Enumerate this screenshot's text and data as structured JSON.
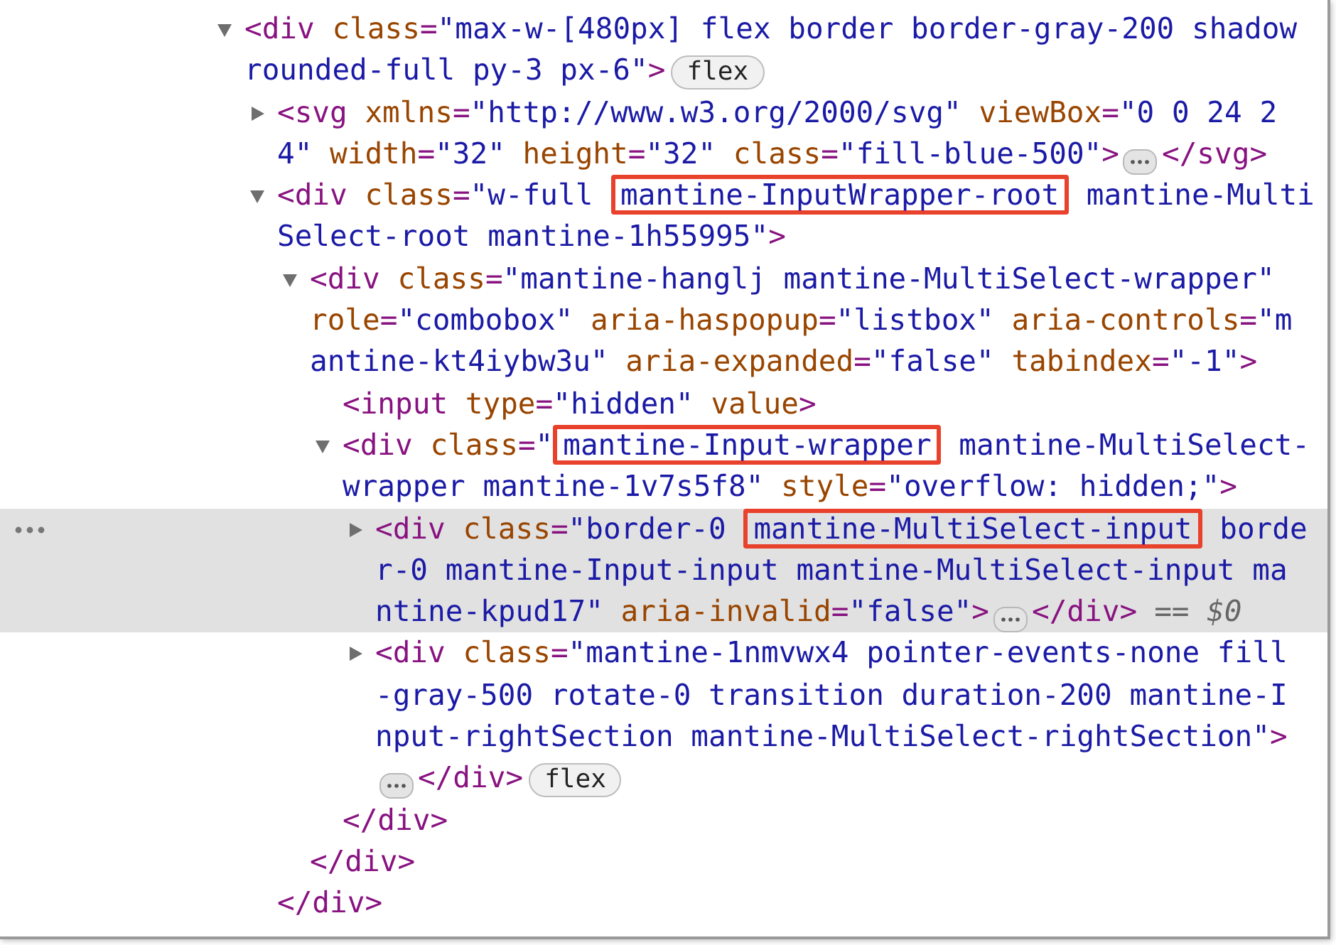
{
  "dom_tree": [
    {
      "expanded": true,
      "selected": false,
      "lines": [
        [
          {
            "kind": "tag",
            "text": "<div"
          },
          {
            "kind": "attr",
            "text": " class"
          },
          {
            "kind": "tag",
            "text": "="
          },
          {
            "kind": "value",
            "text": "\"max-w-[480px] flex border border-gray-200 shadow"
          }
        ],
        [
          {
            "kind": "value",
            "text": "rounded-full py-3 px-6\""
          },
          {
            "kind": "tag",
            "text": ">"
          },
          {
            "kind": "badge",
            "text": "flex"
          }
        ]
      ],
      "children": [
        {
          "expanded": false,
          "selected": false,
          "lines": [
            [
              {
                "kind": "tag",
                "text": "<svg"
              },
              {
                "kind": "attr",
                "text": " xmlns"
              },
              {
                "kind": "tag",
                "text": "="
              },
              {
                "kind": "value",
                "text": "\"http://www.w3.org/2000/svg\""
              },
              {
                "kind": "attr",
                "text": " viewBox"
              },
              {
                "kind": "tag",
                "text": "="
              },
              {
                "kind": "value",
                "text": "\"0 0 24 2"
              }
            ],
            [
              {
                "kind": "value",
                "text": "4\""
              },
              {
                "kind": "attr",
                "text": " width"
              },
              {
                "kind": "tag",
                "text": "="
              },
              {
                "kind": "value",
                "text": "\"32\""
              },
              {
                "kind": "attr",
                "text": " height"
              },
              {
                "kind": "tag",
                "text": "="
              },
              {
                "kind": "value",
                "text": "\"32\""
              },
              {
                "kind": "attr",
                "text": " class"
              },
              {
                "kind": "tag",
                "text": "="
              },
              {
                "kind": "value",
                "text": "\"fill-blue-500\""
              },
              {
                "kind": "tag",
                "text": ">"
              },
              {
                "kind": "ellipsis"
              },
              {
                "kind": "tag",
                "text": "</svg>"
              }
            ]
          ]
        },
        {
          "expanded": true,
          "selected": false,
          "lines": [
            [
              {
                "kind": "tag",
                "text": "<div"
              },
              {
                "kind": "attr",
                "text": " class"
              },
              {
                "kind": "tag",
                "text": "="
              },
              {
                "kind": "value",
                "text": "\"w-full "
              },
              {
                "kind": "highlight",
                "text": "mantine-InputWrapper-root"
              },
              {
                "kind": "value",
                "text": " mantine-Multi"
              }
            ],
            [
              {
                "kind": "value",
                "text": "Select-root mantine-1h55995\""
              },
              {
                "kind": "tag",
                "text": ">"
              }
            ]
          ],
          "closing": "</div>",
          "children": [
            {
              "expanded": true,
              "selected": false,
              "lines": [
                [
                  {
                    "kind": "tag",
                    "text": "<div"
                  },
                  {
                    "kind": "attr",
                    "text": " class"
                  },
                  {
                    "kind": "tag",
                    "text": "="
                  },
                  {
                    "kind": "value",
                    "text": "\"mantine-hanglj mantine-MultiSelect-wrapper\""
                  }
                ],
                [
                  {
                    "kind": "attr",
                    "text": "role"
                  },
                  {
                    "kind": "tag",
                    "text": "="
                  },
                  {
                    "kind": "value",
                    "text": "\"combobox\""
                  },
                  {
                    "kind": "attr",
                    "text": " aria-haspopup"
                  },
                  {
                    "kind": "tag",
                    "text": "="
                  },
                  {
                    "kind": "value",
                    "text": "\"listbox\""
                  },
                  {
                    "kind": "attr",
                    "text": " aria-controls"
                  },
                  {
                    "kind": "tag",
                    "text": "="
                  },
                  {
                    "kind": "value",
                    "text": "\"m"
                  }
                ],
                [
                  {
                    "kind": "value",
                    "text": "antine-kt4iybw3u\""
                  },
                  {
                    "kind": "attr",
                    "text": " aria-expanded"
                  },
                  {
                    "kind": "tag",
                    "text": "="
                  },
                  {
                    "kind": "value",
                    "text": "\"false\""
                  },
                  {
                    "kind": "attr",
                    "text": " tabindex"
                  },
                  {
                    "kind": "tag",
                    "text": "="
                  },
                  {
                    "kind": "value",
                    "text": "\"-1\""
                  },
                  {
                    "kind": "tag",
                    "text": ">"
                  }
                ]
              ],
              "closing": "</div>",
              "children": [
                {
                  "selected": false,
                  "lines": [
                    [
                      {
                        "kind": "tag",
                        "text": "<input"
                      },
                      {
                        "kind": "attr",
                        "text": " type"
                      },
                      {
                        "kind": "tag",
                        "text": "="
                      },
                      {
                        "kind": "value",
                        "text": "\"hidden\""
                      },
                      {
                        "kind": "attr",
                        "text": " value"
                      },
                      {
                        "kind": "tag",
                        "text": ">"
                      }
                    ]
                  ]
                },
                {
                  "expanded": true,
                  "selected": false,
                  "lines": [
                    [
                      {
                        "kind": "tag",
                        "text": "<div"
                      },
                      {
                        "kind": "attr",
                        "text": " class"
                      },
                      {
                        "kind": "tag",
                        "text": "="
                      },
                      {
                        "kind": "value",
                        "text": "\""
                      },
                      {
                        "kind": "highlight",
                        "text": "mantine-Input-wrapper"
                      },
                      {
                        "kind": "value",
                        "text": " mantine-MultiSelect-"
                      }
                    ],
                    [
                      {
                        "kind": "value",
                        "text": "wrapper mantine-1v7s5f8\""
                      },
                      {
                        "kind": "attr",
                        "text": " style"
                      },
                      {
                        "kind": "tag",
                        "text": "="
                      },
                      {
                        "kind": "value",
                        "text": "\"overflow: hidden;\""
                      },
                      {
                        "kind": "tag",
                        "text": ">"
                      }
                    ]
                  ],
                  "closing": "</div>",
                  "children": [
                    {
                      "expanded": false,
                      "selected": true,
                      "lines": [
                        [
                          {
                            "kind": "tag",
                            "text": "<div"
                          },
                          {
                            "kind": "attr",
                            "text": " class"
                          },
                          {
                            "kind": "tag",
                            "text": "="
                          },
                          {
                            "kind": "value",
                            "text": "\"border-0 "
                          },
                          {
                            "kind": "highlight",
                            "text": "mantine-MultiSelect-input"
                          },
                          {
                            "kind": "value",
                            "text": " borde"
                          }
                        ],
                        [
                          {
                            "kind": "value",
                            "text": "r-0 mantine-Input-input mantine-MultiSelect-input ma"
                          }
                        ],
                        [
                          {
                            "kind": "value",
                            "text": "ntine-kpud17\""
                          },
                          {
                            "kind": "attr",
                            "text": " aria-invalid"
                          },
                          {
                            "kind": "tag",
                            "text": "="
                          },
                          {
                            "kind": "value",
                            "text": "\"false\""
                          },
                          {
                            "kind": "tag",
                            "text": ">"
                          },
                          {
                            "kind": "ellipsis"
                          },
                          {
                            "kind": "tag",
                            "text": "</div>"
                          },
                          {
                            "kind": "hint",
                            "text": "== *$0*"
                          }
                        ]
                      ]
                    },
                    {
                      "expanded": false,
                      "selected": false,
                      "lines": [
                        [
                          {
                            "kind": "tag",
                            "text": "<div"
                          },
                          {
                            "kind": "attr",
                            "text": " class"
                          },
                          {
                            "kind": "tag",
                            "text": "="
                          },
                          {
                            "kind": "value",
                            "text": "\"mantine-1nmvwx4 pointer-events-none fill"
                          }
                        ],
                        [
                          {
                            "kind": "value",
                            "text": "-gray-500 rotate-0 transition duration-200 mantine-I"
                          }
                        ],
                        [
                          {
                            "kind": "value",
                            "text": "nput-rightSection mantine-MultiSelect-rightSection\""
                          },
                          {
                            "kind": "tag",
                            "text": ">"
                          }
                        ],
                        [
                          {
                            "kind": "ellipsis"
                          },
                          {
                            "kind": "tag",
                            "text": "</div>"
                          },
                          {
                            "kind": "badge",
                            "text": "flex"
                          }
                        ]
                      ]
                    }
                  ]
                }
              ]
            }
          ]
        }
      ]
    }
  ]
}
